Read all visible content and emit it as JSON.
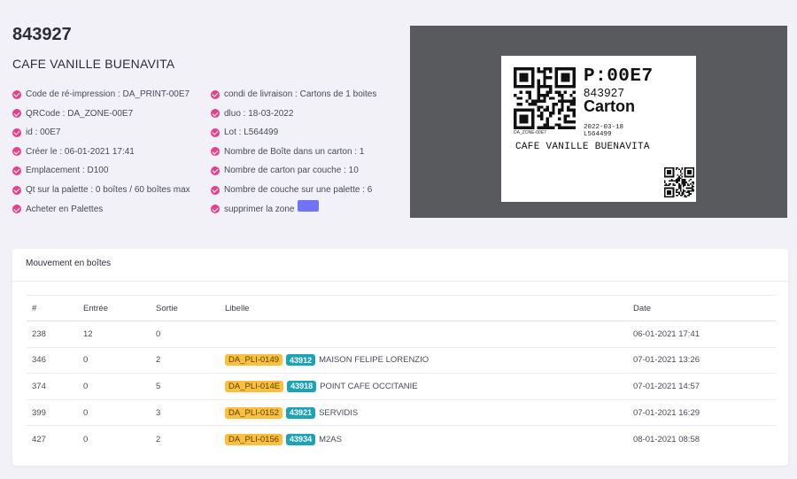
{
  "product": {
    "id": "843927",
    "name": "CAFE VANILLE BUENAVITA"
  },
  "details_left": [
    "Code de ré-impression : DA_PRINT-00E7",
    "QRCode : DA_ZONE-00E7",
    "id : 00E7",
    "Créer le : 06-01-2021 17:41",
    "Emplacement : D100",
    "Qt sur la palette : 0 boîtes / 60 boîtes max",
    "Acheter en Palettes"
  ],
  "details_right": [
    "condi de livraison : Cartons de 1 boites",
    "dluo : 18-03-2022",
    "Lot : L564499",
    "Nombre de Boîte dans un carton : 1",
    "Nombre de carton par couche : 10",
    "Nombre de couche sur une palette : 6",
    "supprimer la zone"
  ],
  "label": {
    "code": "P:00E7",
    "number": "843927",
    "type": "Carton",
    "date": "2022-03-18",
    "lot": "L564499",
    "qr_caption": "DA_ZONE-00E7",
    "product_name": "CAFE VANILLE BUENAVITA"
  },
  "colors": {
    "check": "#e83e8c",
    "zone_button": "#6f73f5",
    "badge_pli": "#fbbf3e",
    "badge_num": "#1ba3b7",
    "label_panel": "#595a5e"
  },
  "movements": {
    "title": "Mouvement en boîtes",
    "columns": [
      "#",
      "Entrée",
      "Sortie",
      "Libelle",
      "Date"
    ],
    "rows": [
      {
        "id": "238",
        "entree": "12",
        "sortie": "0",
        "pli": "",
        "num": "",
        "libelle": "",
        "date": "06-01-2021 17:41"
      },
      {
        "id": "346",
        "entree": "0",
        "sortie": "2",
        "pli": "DA_PLI-0149",
        "num": "43912",
        "libelle": "MAISON FELIPE LORENZIO",
        "date": "07-01-2021 13:26"
      },
      {
        "id": "374",
        "entree": "0",
        "sortie": "5",
        "pli": "DA_PLI-014E",
        "num": "43918",
        "libelle": "POINT CAFE OCCITANIE",
        "date": "07-01-2021 14:57"
      },
      {
        "id": "399",
        "entree": "0",
        "sortie": "3",
        "pli": "DA_PLI-0152",
        "num": "43921",
        "libelle": "SERVIDIS",
        "date": "07-01-2021 16:29"
      },
      {
        "id": "427",
        "entree": "0",
        "sortie": "2",
        "pli": "DA_PLI-0156",
        "num": "43934",
        "libelle": "M2AS",
        "date": "08-01-2021 08:58"
      }
    ]
  }
}
